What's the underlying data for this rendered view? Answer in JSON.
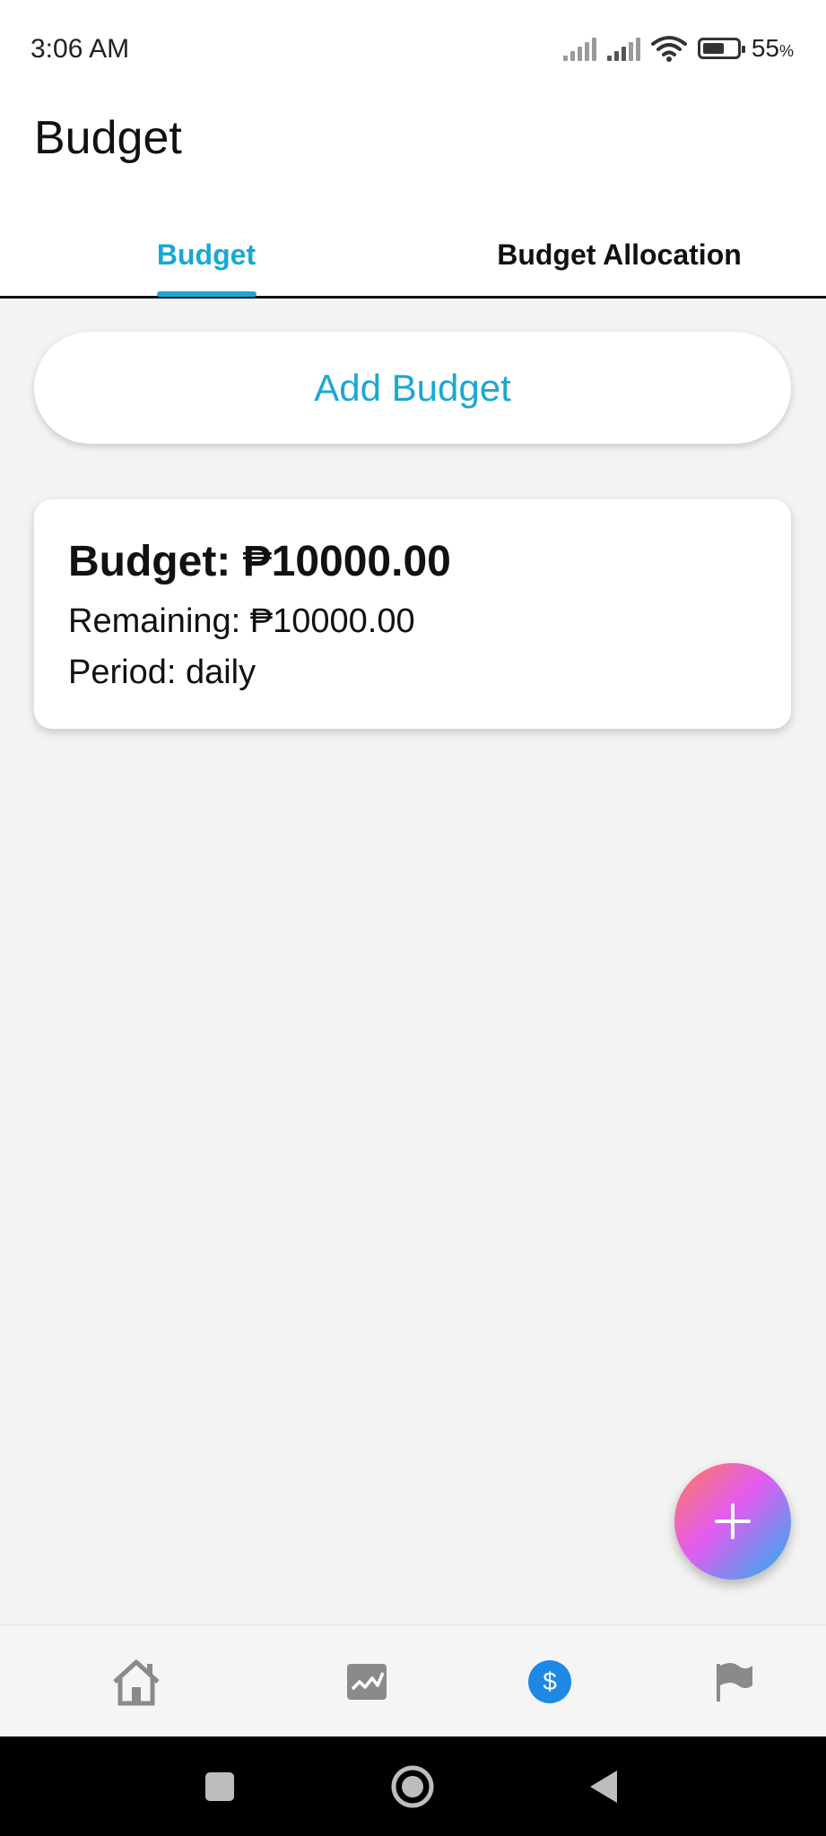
{
  "status_bar": {
    "time": "3:06 AM",
    "battery_percent": "55",
    "battery_unit": "%",
    "icons": [
      "signal-icon",
      "signal-icon",
      "wifi-icon",
      "battery-icon"
    ]
  },
  "header": {
    "title": "Budget"
  },
  "tabs": [
    {
      "label": "Budget",
      "active": true
    },
    {
      "label": "Budget Allocation",
      "active": false
    }
  ],
  "actions": {
    "add_budget_label": "Add Budget"
  },
  "budget_card": {
    "amount_line": "Budget: ₱10000.00",
    "remaining_line": "Remaining: ₱10000.00",
    "period_line": "Period: daily"
  },
  "fab": {
    "icon": "plus-icon"
  },
  "bottom_nav": {
    "items": [
      {
        "icon": "home-icon"
      },
      {
        "icon": "chart-icon"
      },
      {
        "icon": "dollar-icon",
        "active": true
      },
      {
        "icon": "flag-icon"
      }
    ]
  },
  "colors": {
    "accent": "#19a8d4",
    "active_nav": "#1e88e5",
    "background": "#f3f3f3"
  }
}
